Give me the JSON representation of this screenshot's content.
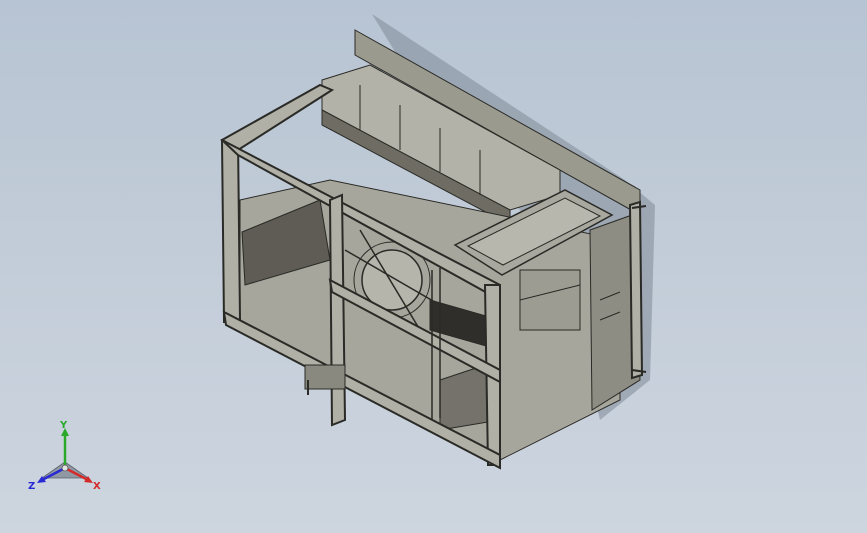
{
  "viewport": {
    "background_top": "#b7c4d3",
    "background_bottom": "#cdd5df"
  },
  "model": {
    "edge_color": "#2a2a26",
    "body_color": "#a7a69c",
    "dark_color": "#6f6d63",
    "shadow_color": "#7f8a97"
  },
  "triad": {
    "x_label": "X",
    "y_label": "Y",
    "z_label": "Z",
    "x_color": "#d42a2a",
    "y_color": "#2aa82a",
    "z_color": "#2a2ad4"
  }
}
